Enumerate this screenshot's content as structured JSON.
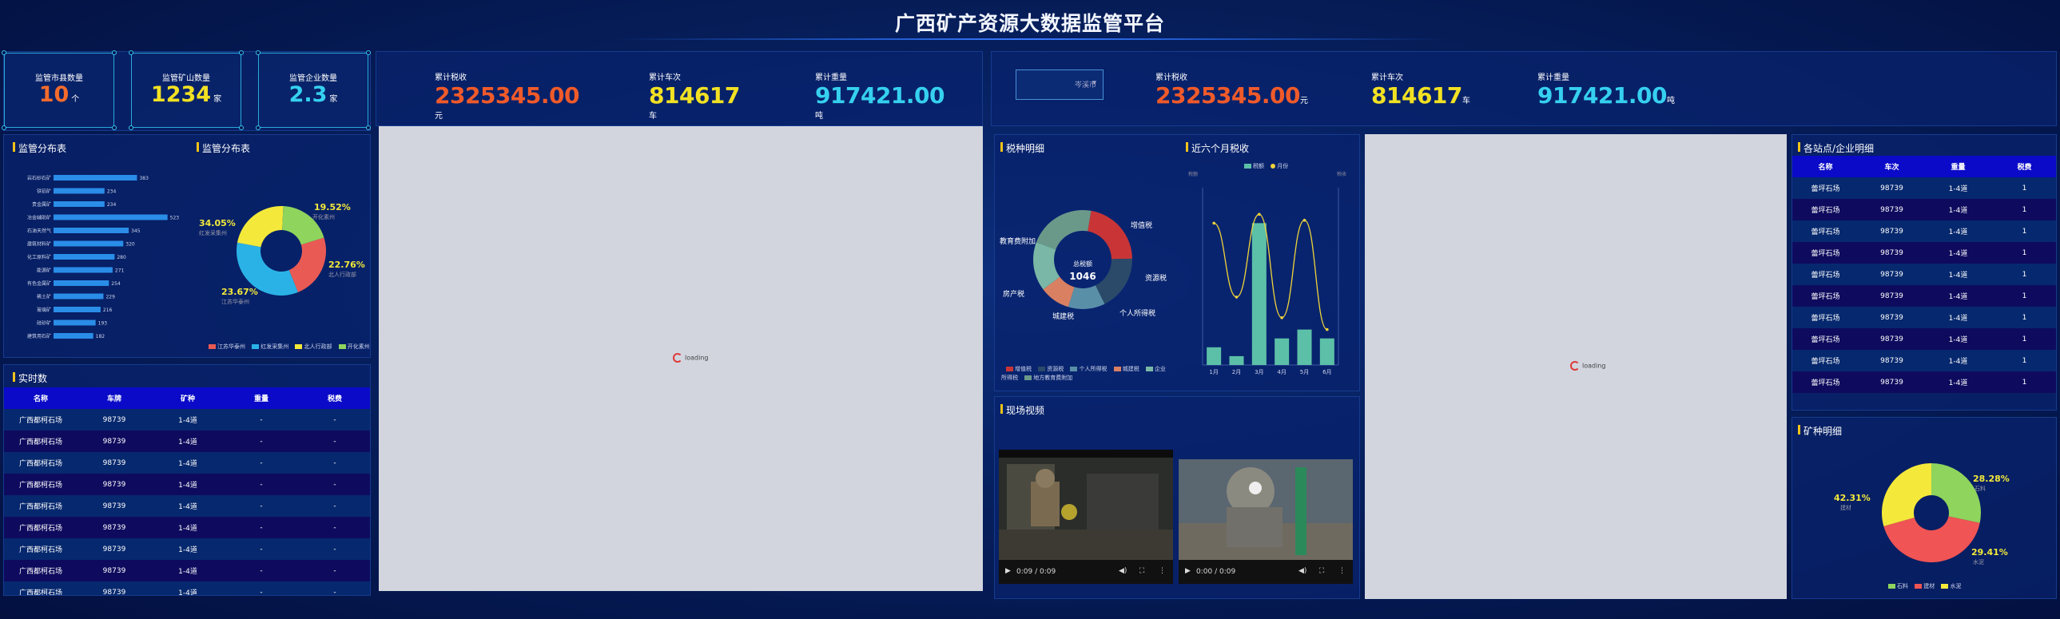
{
  "title": "广西矿产资源大数据监管平台",
  "kpis": [
    {
      "label": "监管市县数量",
      "value": "10",
      "unit": "个",
      "color": "#f36b2c"
    },
    {
      "label": "监管矿山数量",
      "value": "1234",
      "unit": "家",
      "color": "#f2e123"
    },
    {
      "label": "监管企业数量",
      "value": "2.3",
      "unit": "家",
      "color": "#36d0f0"
    }
  ],
  "stats": {
    "tax_label": "累计税收",
    "tax_value": "2325345.00",
    "tax_unit": "元",
    "trips_label": "累计车次",
    "trips_value": "814617",
    "trips_unit": "车",
    "weight_label": "累计重量",
    "weight_value": "917421.00",
    "weight_unit": "吨"
  },
  "city_select": "岑溪市",
  "left_panel": {
    "title1": "监管分布表",
    "title2": "监管分布表"
  },
  "bar_chart": {
    "type": "bar",
    "orientation": "horizontal",
    "categories": [
      "岩石砂石矿",
      "铁铝矿",
      "贵金属矿",
      "冶金辅助矿",
      "石油天然气",
      "建筑材料矿",
      "化工原料矿",
      "能源矿",
      "有色金属矿",
      "稀土矿",
      "玻璃矿",
      "硅砂矿",
      "建筑用石矿"
    ],
    "values": [
      383,
      234,
      234,
      523,
      345,
      320,
      280,
      271,
      254,
      229,
      216,
      193,
      182
    ]
  },
  "pie1": {
    "type": "pie",
    "series": [
      {
        "name": "江苏华泰州",
        "value": 23.67,
        "color": "#ea5a54"
      },
      {
        "name": "红发采集州",
        "value": 34.05,
        "color": "#2ab2e6"
      },
      {
        "name": "北人行政部",
        "value": 22.76,
        "color": "#f4e93a"
      },
      {
        "name": "开化素州",
        "value": 19.52,
        "color": "#8fd45d"
      }
    ],
    "labels": [
      "34.05%",
      "19.52%",
      "22.76%",
      "23.67%"
    ],
    "sublabels": [
      "红发采集州",
      "开化素州",
      "北人行政部",
      "江苏华泰州"
    ]
  },
  "realtime": {
    "title": "实时数",
    "headers": [
      "名称",
      "车牌",
      "矿种",
      "重量",
      "税费"
    ],
    "rows": [
      [
        "广西都柯石场",
        "98739",
        "1-4道",
        "-",
        "-"
      ],
      [
        "广西都柯石场",
        "98739",
        "1-4道",
        "-",
        "-"
      ],
      [
        "广西都柯石场",
        "98739",
        "1-4道",
        "-",
        "-"
      ],
      [
        "广西都柯石场",
        "98739",
        "1-4道",
        "-",
        "-"
      ],
      [
        "广西都柯石场",
        "98739",
        "1-4道",
        "-",
        "-"
      ],
      [
        "广西都柯石场",
        "98739",
        "1-4道",
        "-",
        "-"
      ],
      [
        "广西都柯石场",
        "98739",
        "1-4道",
        "-",
        "-"
      ],
      [
        "广西都柯石场",
        "98739",
        "1-4道",
        "-",
        "-"
      ],
      [
        "广西都柯石场",
        "98739",
        "1-4道",
        "-",
        "-"
      ]
    ]
  },
  "loading_text": "loading",
  "tax_detail": {
    "title": "税种明细",
    "center_label": "总税额",
    "center_value": "1046",
    "labels": [
      "增值税",
      "资源税",
      "个人所得税",
      "城建税",
      "房产税",
      "教育费附加"
    ],
    "legend": [
      "增值税",
      "资源税",
      "个人所得税",
      "城建税",
      "企业所得税",
      "地方教育费附加"
    ]
  },
  "donut_tax": {
    "type": "pie",
    "series": [
      {
        "name": "增值税",
        "value": 22,
        "color": "#c93536"
      },
      {
        "name": "资源税",
        "value": 18,
        "color": "#2b4a6a"
      },
      {
        "name": "个人所得税",
        "value": 12,
        "color": "#5a8fa8"
      },
      {
        "name": "城建税",
        "value": 10,
        "color": "#d98063"
      },
      {
        "name": "企业所得税",
        "value": 16,
        "color": "#7ab7a6"
      },
      {
        "name": "地方教育费附加",
        "value": 22,
        "color": "#6a998a"
      }
    ]
  },
  "six_month": {
    "title": "近六个月税收",
    "legend": [
      "税额",
      "月份"
    ],
    "axis_left": "税额",
    "axis_right": "税收"
  },
  "combo_chart": {
    "type": "bar",
    "categories": [
      "1月",
      "2月",
      "3月",
      "4月",
      "5月",
      "6月"
    ],
    "series": [
      {
        "name": "税额",
        "values": [
          20,
          10,
          160,
          30,
          40,
          30
        ],
        "color": "#5cc0a8"
      },
      {
        "name": "月份",
        "values": [
          480,
          230,
          510,
          160,
          490,
          120
        ],
        "color": "#f0d43a"
      }
    ],
    "ylim_left": [
      0,
      200
    ],
    "ylim_right": [
      0,
      600
    ]
  },
  "video": {
    "title": "现场视频",
    "v1_time": "0:09 / 0:09",
    "v2_time": "0:00 / 0:09"
  },
  "stations": {
    "title": "各站点/企业明细",
    "headers": [
      "名称",
      "车次",
      "重量",
      "税费"
    ],
    "rows": [
      [
        "蕾坪石场",
        "98739",
        "1-4道",
        "1"
      ],
      [
        "蕾坪石场",
        "98739",
        "1-4道",
        "1"
      ],
      [
        "蕾坪石场",
        "98739",
        "1-4道",
        "1"
      ],
      [
        "蕾坪石场",
        "98739",
        "1-4道",
        "1"
      ],
      [
        "蕾坪石场",
        "98739",
        "1-4道",
        "1"
      ],
      [
        "蕾坪石场",
        "98739",
        "1-4道",
        "1"
      ],
      [
        "蕾坪石场",
        "98739",
        "1-4道",
        "1"
      ],
      [
        "蕾坪石场",
        "98739",
        "1-4道",
        "1"
      ],
      [
        "蕾坪石场",
        "98739",
        "1-4道",
        "1"
      ],
      [
        "蕾坪石场",
        "98739",
        "1-4道",
        "1"
      ]
    ]
  },
  "minerals": {
    "title": "矿种明细",
    "labels": [
      "42.31%",
      "28.28%",
      "29.41%"
    ],
    "sublabels": [
      "建材",
      "石料",
      "水泥"
    ],
    "legend": [
      "石料",
      "建材",
      "水泥"
    ]
  },
  "pie_minerals": {
    "type": "pie",
    "series": [
      {
        "name": "石料",
        "value": 28.28,
        "color": "#8fd45d"
      },
      {
        "name": "建材",
        "value": 42.31,
        "color": "#f05454"
      },
      {
        "name": "水泥",
        "value": 29.41,
        "color": "#f4e93a"
      }
    ]
  }
}
